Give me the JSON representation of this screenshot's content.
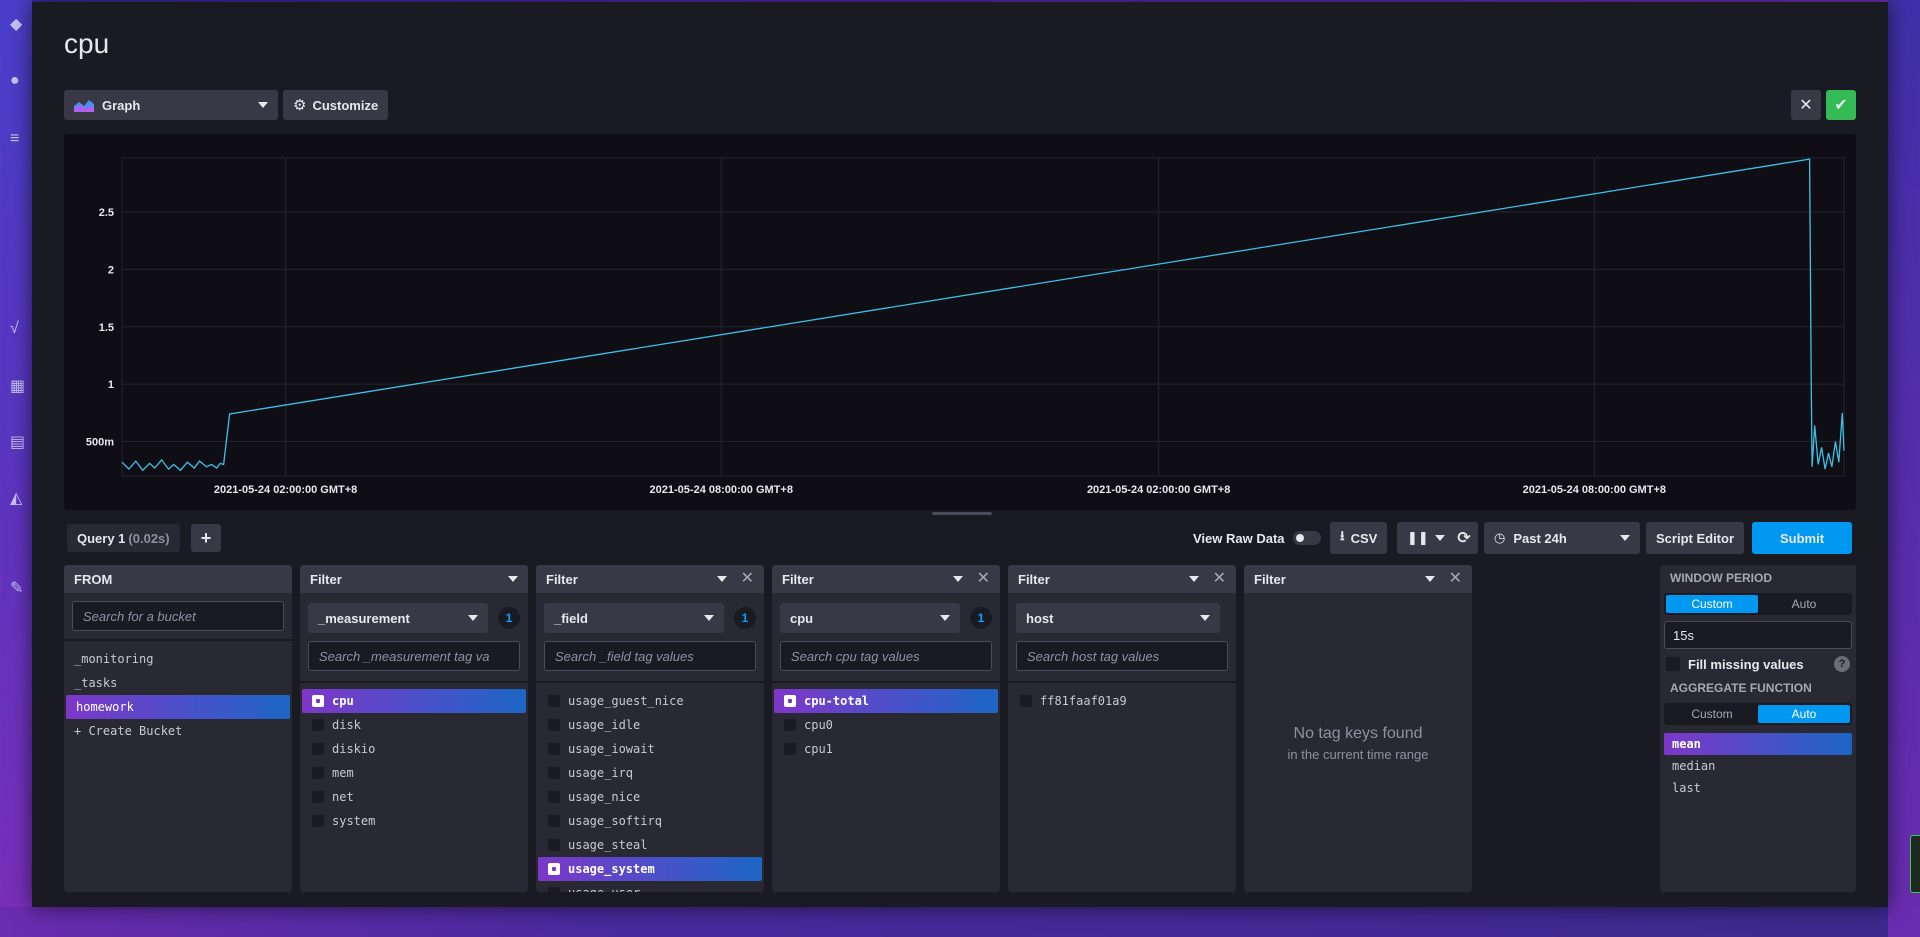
{
  "page": {
    "title": "cpu"
  },
  "toolbar": {
    "graph_type": "Graph",
    "customize_label": "Customize",
    "close_icon": "close-icon",
    "confirm_icon": "check-icon"
  },
  "chart_data": {
    "type": "line",
    "y_ticks": [
      "500m",
      "1",
      "1.5",
      "2",
      "2.5"
    ],
    "y_tick_values": [
      0.5,
      1,
      1.5,
      2,
      2.5
    ],
    "ylim": [
      0.2,
      2.97
    ],
    "x_ticks": [
      "2021-05-24 02:00:00 GMT+8",
      "2021-05-24 08:00:00 GMT+8",
      "2021-05-24 02:00:00 GMT+8",
      "2021-05-24 08:00:00 GMT+8"
    ],
    "series": [
      {
        "name": "",
        "color": "#3ec0e8",
        "points": [
          [
            0.0,
            0.32
          ],
          [
            0.004,
            0.26
          ],
          [
            0.008,
            0.33
          ],
          [
            0.012,
            0.25
          ],
          [
            0.016,
            0.31
          ],
          [
            0.019,
            0.27
          ],
          [
            0.023,
            0.34
          ],
          [
            0.027,
            0.26
          ],
          [
            0.03,
            0.3
          ],
          [
            0.034,
            0.25
          ],
          [
            0.038,
            0.32
          ],
          [
            0.042,
            0.27
          ],
          [
            0.045,
            0.33
          ],
          [
            0.049,
            0.28
          ],
          [
            0.052,
            0.3
          ],
          [
            0.055,
            0.27
          ],
          [
            0.057,
            0.31
          ],
          [
            0.059,
            0.3
          ],
          [
            0.0625,
            0.74
          ],
          [
            0.98,
            2.96
          ],
          [
            0.981,
            0.95
          ],
          [
            0.9815,
            0.28
          ],
          [
            0.983,
            0.64
          ],
          [
            0.985,
            0.3
          ],
          [
            0.987,
            0.45
          ],
          [
            0.989,
            0.26
          ],
          [
            0.991,
            0.4
          ],
          [
            0.993,
            0.28
          ],
          [
            0.995,
            0.5
          ],
          [
            0.997,
            0.32
          ],
          [
            0.999,
            0.75
          ],
          [
            1.0,
            0.42
          ]
        ]
      }
    ]
  },
  "query": {
    "tab_label": "Query 1",
    "tab_time": "(0.02s)",
    "add_label": "+",
    "view_raw": "View Raw Data",
    "csv_label": "CSV",
    "pause_icon": "pause-icon",
    "time_range": "Past 24h",
    "script_editor": "Script Editor",
    "submit": "Submit"
  },
  "from": {
    "header": "FROM",
    "search_placeholder": "Search for a bucket",
    "buckets": [
      "_monitoring",
      "_tasks",
      "homework",
      "+ Create Bucket"
    ]
  },
  "filters": [
    {
      "header": "Filter",
      "key": "_measurement",
      "count": "1",
      "search_placeholder": "Search _measurement tag va",
      "items": [
        "cpu",
        "disk",
        "diskio",
        "mem",
        "net",
        "system"
      ]
    },
    {
      "header": "Filter",
      "key": "_field",
      "count": "1",
      "search_placeholder": "Search _field tag values",
      "items": [
        "usage_guest_nice",
        "usage_idle",
        "usage_iowait",
        "usage_irq",
        "usage_nice",
        "usage_softirq",
        "usage_steal",
        "usage_system",
        "usage_user"
      ]
    },
    {
      "header": "Filter",
      "key": "cpu",
      "count": "1",
      "search_placeholder": "Search cpu tag values",
      "items": [
        "cpu-total",
        "cpu0",
        "cpu1"
      ]
    },
    {
      "header": "Filter",
      "key": "host",
      "search_placeholder": "Search host tag values",
      "items": [
        "ff81faaf01a9"
      ]
    },
    {
      "header": "Filter",
      "empty_title": "No tag keys found",
      "empty_sub": "in the current time range"
    }
  ],
  "aggregate": {
    "window_label": "WINDOW PERIOD",
    "window_custom": "Custom",
    "window_auto": "Auto",
    "window_value": "15s",
    "fill_missing": "Fill missing values",
    "help": "?",
    "func_label": "AGGREGATE FUNCTION",
    "func_custom": "Custom",
    "func_auto": "Auto",
    "functions": [
      "mean",
      "median",
      "last"
    ]
  }
}
